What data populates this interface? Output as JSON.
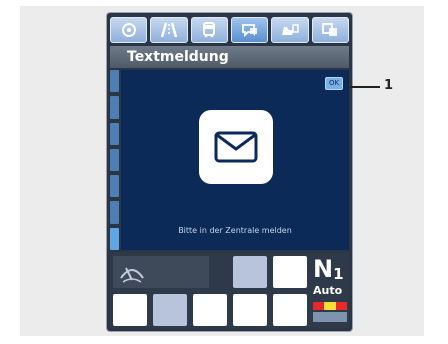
{
  "title": "Textmeldung",
  "message": "Bitte in der Zentrale melden",
  "badge": "OK",
  "callout": "1",
  "tabs": [
    {
      "icon": "settings-circle-icon",
      "active": false
    },
    {
      "icon": "road-icon",
      "active": false
    },
    {
      "icon": "bus-icon",
      "active": false
    },
    {
      "icon": "chat-bubble-icon",
      "active": true
    },
    {
      "icon": "driver-icon",
      "active": false
    },
    {
      "icon": "info-panel-icon",
      "active": false
    }
  ],
  "status": {
    "icon": "wiper-icon",
    "small_top": "",
    "small_mid": "",
    "small_right": "",
    "bottom_label": ""
  },
  "gear": {
    "letter": "N",
    "subscript": "1",
    "mode": "Auto",
    "colors": [
      "#e8292b",
      "#f6e036",
      "#e8292b"
    ]
  }
}
